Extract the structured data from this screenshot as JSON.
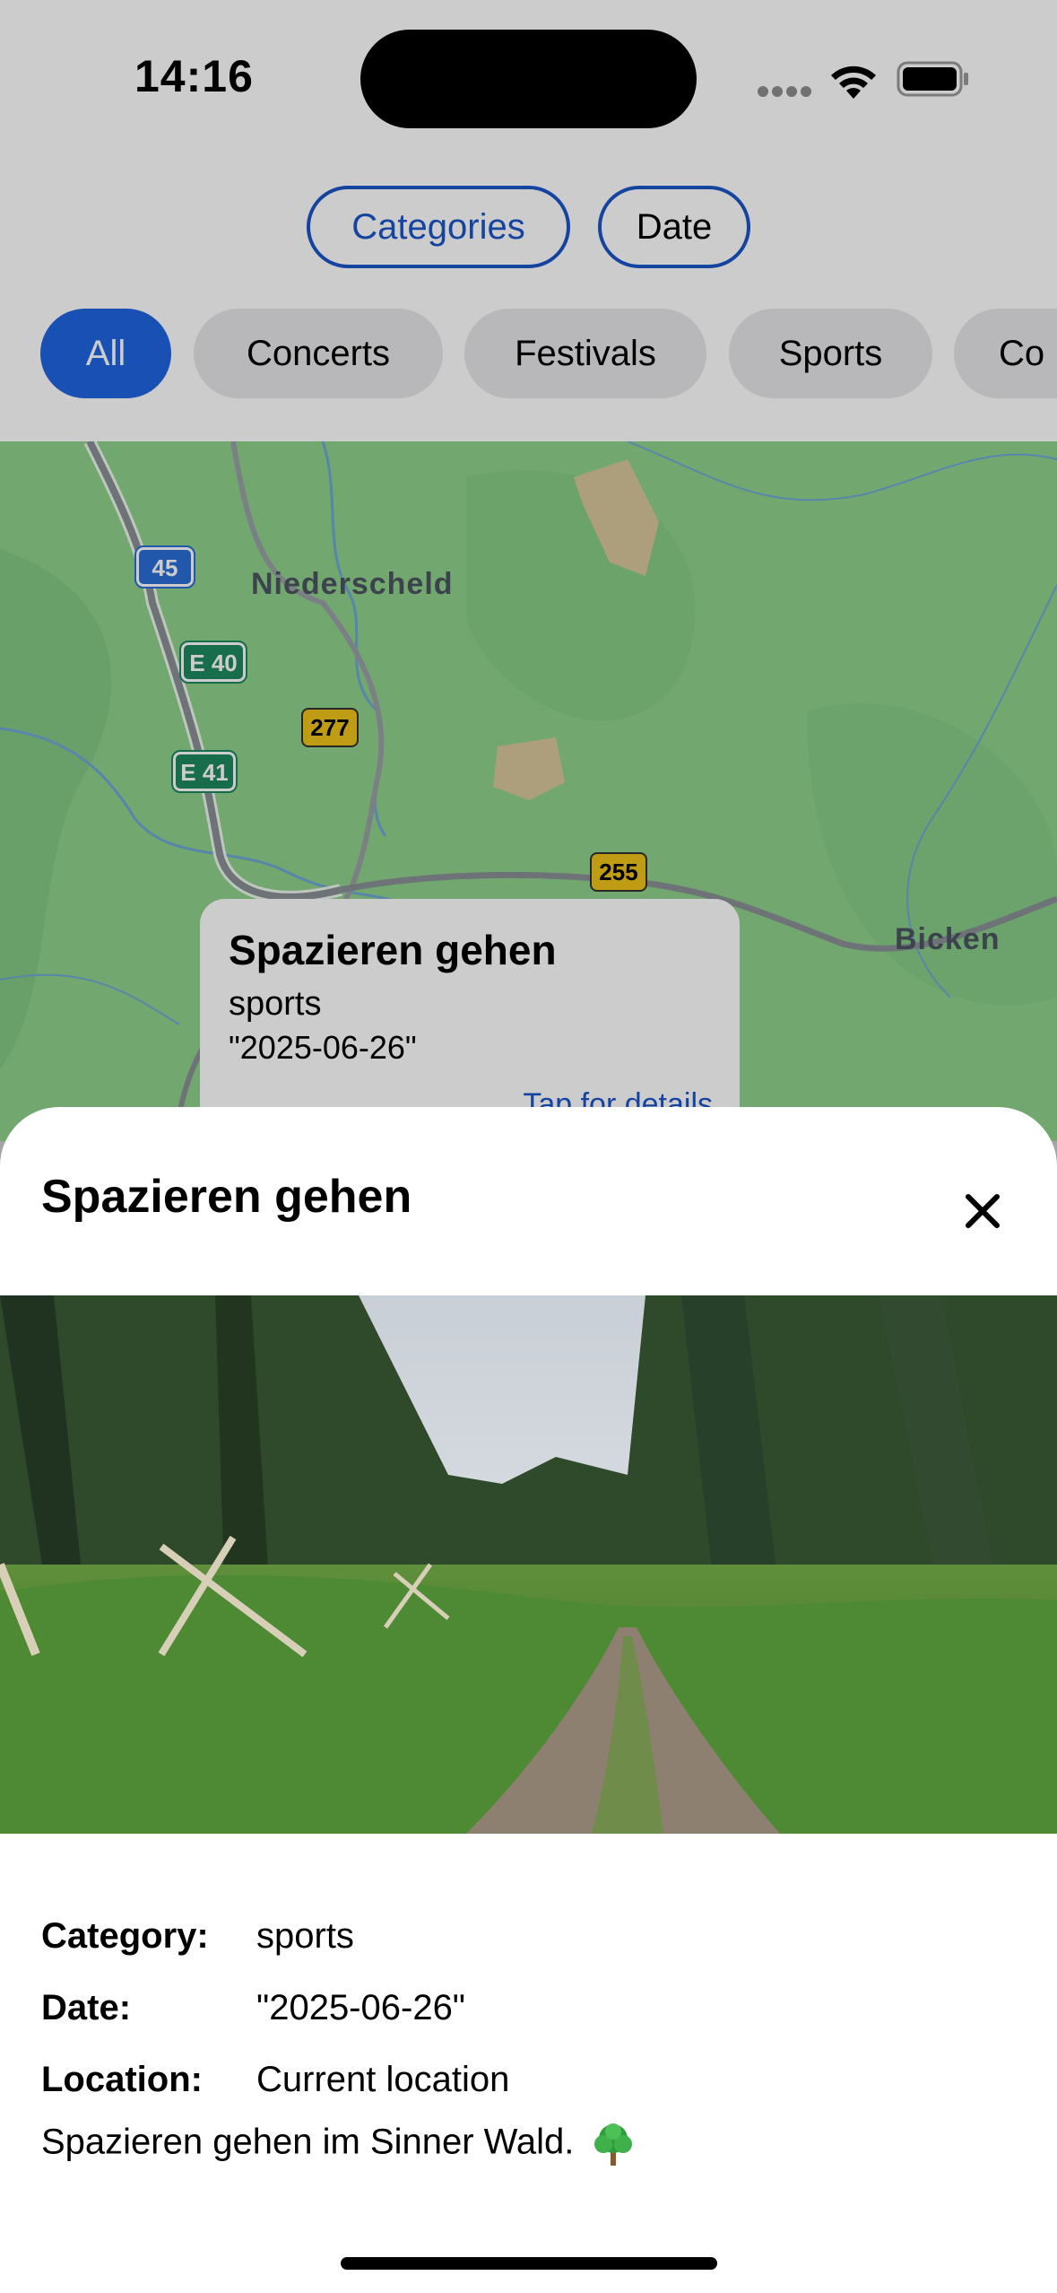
{
  "status_bar": {
    "time": "14:16"
  },
  "segmented": {
    "categories_label": "Categories",
    "date_label": "Date"
  },
  "chips": [
    "All",
    "Concerts",
    "Festivals",
    "Sports",
    "Co"
  ],
  "map": {
    "places": [
      "Niederscheld",
      "Bicken"
    ],
    "road_shields": [
      "45",
      "E 40",
      "E 41",
      "277",
      "255"
    ]
  },
  "callout": {
    "title": "Spazieren gehen",
    "category": "sports",
    "date": "\"2025-06-26\"",
    "tap_label": "Tap for details"
  },
  "sheet": {
    "title": "Spazieren gehen",
    "details": [
      {
        "key": "Category:",
        "value": "sports"
      },
      {
        "key": "Date:",
        "value": "\"2025-06-26\""
      },
      {
        "key": "Location:",
        "value": "Current location"
      }
    ],
    "description": "Spazieren gehen im Sinner Wald."
  },
  "colors": {
    "accent": "#1a56c9",
    "active_chip": "#1f66e0",
    "map_green": "#8fd28c"
  },
  "icons": [
    "wifi-icon",
    "battery-icon",
    "close-icon",
    "tree-icon"
  ]
}
